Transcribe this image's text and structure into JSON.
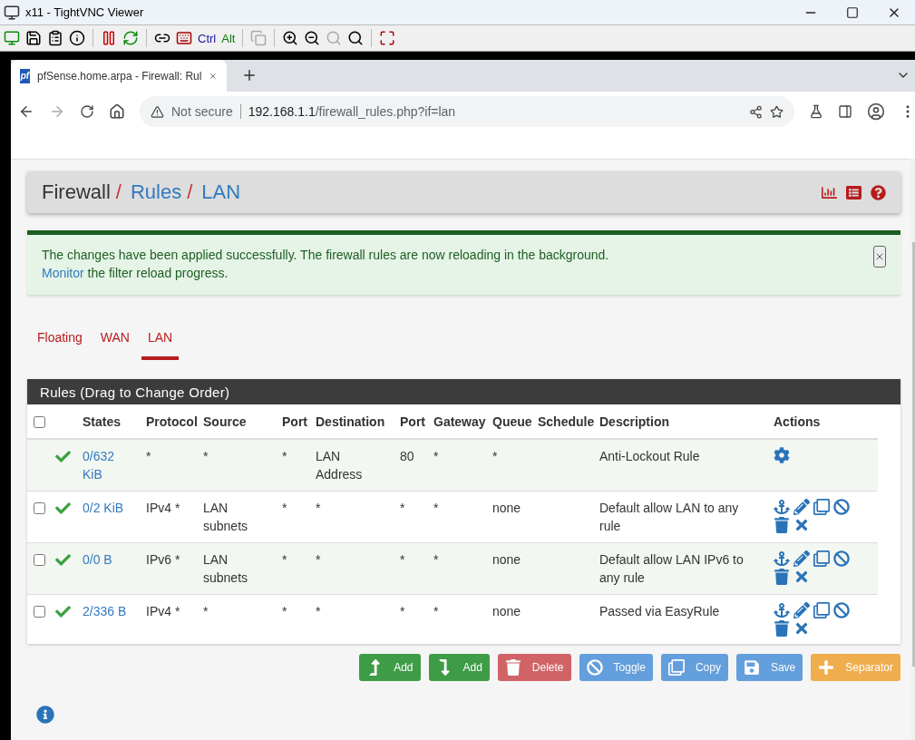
{
  "vnc_window": {
    "title": "x11 - TightVNC Viewer",
    "toolbar_keys": [
      "Ctrl",
      "Alt"
    ]
  },
  "browser": {
    "tab": {
      "favicon": "pf",
      "title": "pfSense.home.arpa - Firewall: Rul"
    },
    "address": {
      "security": "Not secure",
      "host": "192.168.1.1",
      "path": "/firewall_rules.php?if=lan"
    }
  },
  "breadcrumb": [
    {
      "label": "Firewall",
      "link": false
    },
    {
      "label": "Rules",
      "link": true
    },
    {
      "label": "LAN",
      "link": true
    }
  ],
  "breadcrumb_separator": "/",
  "alert": {
    "message": "The changes have been applied successfully. The firewall rules are now reloading in the background.",
    "link": "Monitor",
    "tail": "the filter reload progress."
  },
  "tabs": [
    {
      "label": "Floating",
      "selected": false
    },
    {
      "label": "WAN",
      "selected": false
    },
    {
      "label": "LAN",
      "selected": true
    }
  ],
  "rules": {
    "title": "Rules (Drag to Change Order)",
    "select_all_checked": false,
    "columns": [
      "States",
      "Protocol",
      "Source",
      "Port",
      "Destination",
      "Port",
      "Gateway",
      "Queue",
      "Schedule",
      "Description",
      "Actions"
    ],
    "rows": [
      {
        "kind": "fixed",
        "states": "0/632 KiB",
        "protocol": "*",
        "source": "*",
        "source_port": "*",
        "destination": "LAN Address",
        "destination_port": "80",
        "gateway": "*",
        "queue": "*",
        "description": "Anti-Lockout Rule"
      },
      {
        "kind": "user",
        "checked": false,
        "states": "0/2 KiB",
        "protocol": "IPv4 *",
        "source": "LAN subnets",
        "source_port": "*",
        "destination": "*",
        "destination_port": "*",
        "gateway": "*",
        "queue": "none",
        "description": "Default allow LAN to any rule"
      },
      {
        "kind": "user",
        "checked": false,
        "states": "0/0 B",
        "protocol": "IPv6 *",
        "source": "LAN subnets",
        "source_port": "*",
        "destination": "*",
        "destination_port": "*",
        "gateway": "*",
        "queue": "none",
        "description": "Default allow LAN IPv6 to any rule"
      },
      {
        "kind": "user",
        "checked": false,
        "states": "2/336 B",
        "protocol": "IPv4 *",
        "source": "*",
        "source_port": "*",
        "destination": "*",
        "destination_port": "*",
        "gateway": "*",
        "queue": "none",
        "description": "Passed via EasyRule"
      }
    ]
  },
  "buttons": [
    {
      "kind": "add-top",
      "label": "Add",
      "disabled": false
    },
    {
      "kind": "add-bottom",
      "label": "Add",
      "disabled": false
    },
    {
      "kind": "delete",
      "label": "Delete",
      "disabled": true
    },
    {
      "kind": "toggle",
      "label": "Toggle",
      "disabled": true
    },
    {
      "kind": "copy",
      "label": "Copy",
      "disabled": true
    },
    {
      "kind": "save",
      "label": "Save",
      "disabled": true
    },
    {
      "kind": "separator",
      "label": "Separator",
      "disabled": false
    }
  ]
}
